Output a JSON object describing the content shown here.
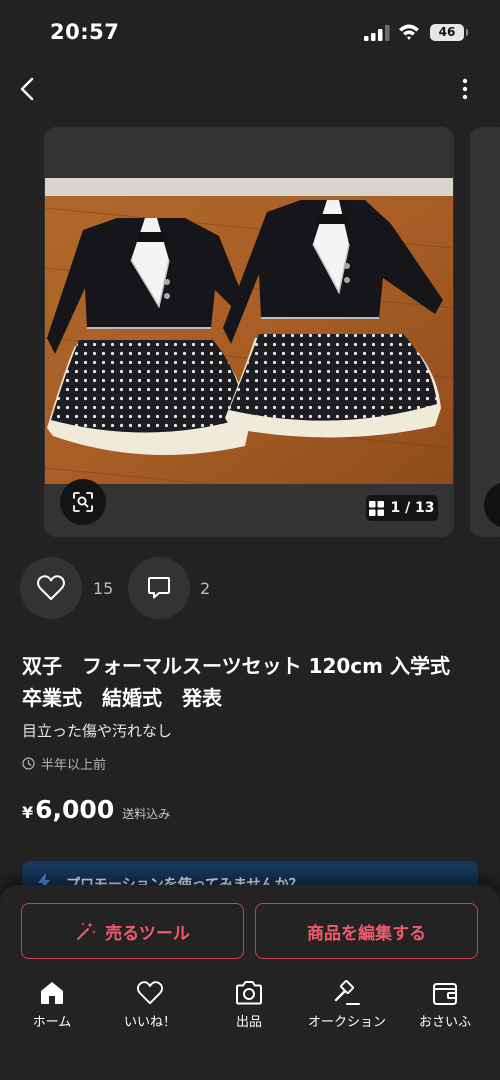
{
  "status_bar": {
    "time": "20:57",
    "battery": "46"
  },
  "image": {
    "counter": "1 / 13"
  },
  "stats": {
    "likes": "15",
    "comments": "2"
  },
  "item": {
    "title": "双子　フォーマルスーツセット 120cm 入学式　卒業式　結婚式　発表",
    "description": "目立った傷や汚れなし",
    "posted": "半年以上前",
    "price_symbol": "¥",
    "price": "6,000",
    "shipping": "送料込み"
  },
  "promo": {
    "text": "プロモーションを使ってみませんか？"
  },
  "actions": {
    "sell_tool": "売るツール",
    "edit_item": "商品を編集する"
  },
  "nav": [
    {
      "label": "ホーム",
      "icon": "home-icon"
    },
    {
      "label": "いいね！",
      "icon": "heart-icon"
    },
    {
      "label": "出品",
      "icon": "camera-icon"
    },
    {
      "label": "オークション",
      "icon": "gavel-icon"
    },
    {
      "label": "おさいふ",
      "icon": "wallet-icon"
    }
  ],
  "colors": {
    "background": "#222222",
    "accent": "#d23f50",
    "promo": "#15385e"
  }
}
